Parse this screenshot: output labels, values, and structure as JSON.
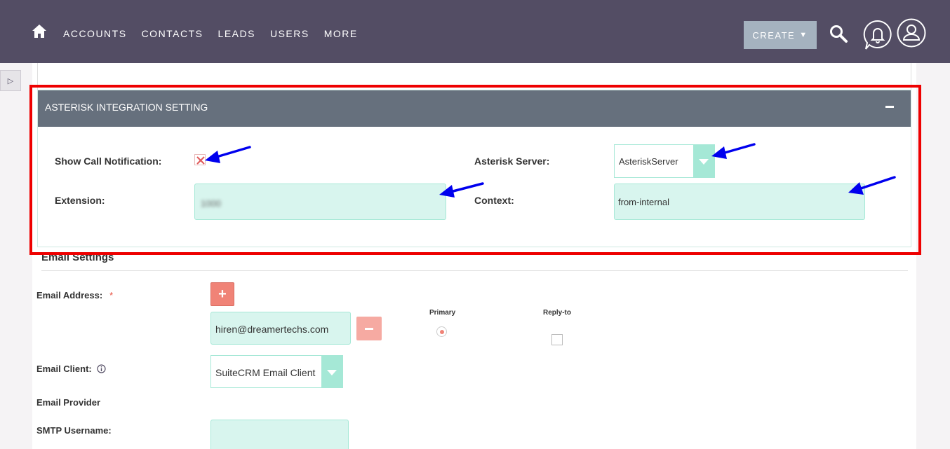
{
  "nav": {
    "items": [
      "ACCOUNTS",
      "CONTACTS",
      "LEADS",
      "USERS",
      "MORE"
    ],
    "create_label": "CREATE",
    "icons": [
      "home-icon",
      "search-icon",
      "bell-icon",
      "user-icon"
    ]
  },
  "asterisk": {
    "title": "ASTERISK INTEGRATION SETTING",
    "show_call_label": "Show Call Notification:",
    "show_call_checked": true,
    "server_label": "Asterisk Server:",
    "server_value": "AsteriskServer",
    "extension_label": "Extension:",
    "extension_value": "1000",
    "context_label": "Context:",
    "context_value": "from-internal"
  },
  "email": {
    "section_title": "Email Settings",
    "address_label": "Email Address:",
    "required_mark": "*",
    "address_value": "hiren@dreamertechs.com",
    "primary_label": "Primary",
    "reply_to_label": "Reply-to",
    "client_label": "Email Client:",
    "client_value": "SuiteCRM Email Client",
    "provider_label": "Email Provider",
    "smtp_username_label": "SMTP Username:"
  },
  "colors": {
    "nav_bg": "#534d64",
    "panel_header": "#66707d",
    "input_bg": "#d8f5ee",
    "highlight": "#ee0000",
    "annotation_arrow": "#0000ee"
  }
}
